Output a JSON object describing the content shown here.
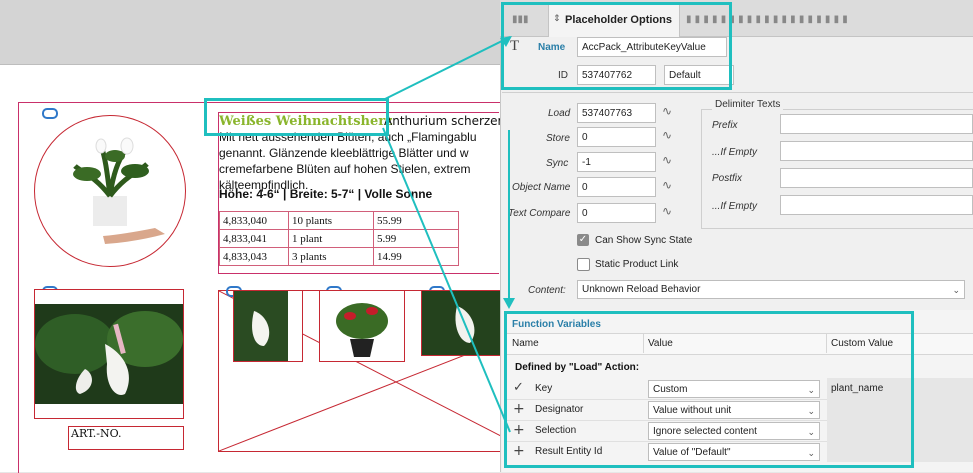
{
  "panel": {
    "tab_title": "Placeholder Options",
    "name_label": "Name",
    "name_value": "AccPack_AttributeKeyValue",
    "id_label": "ID",
    "id_value": "537407762",
    "id_default": "Default",
    "load_label": "Load",
    "load_value": "537407763",
    "store_label": "Store",
    "store_value": "0",
    "sync_label": "Sync",
    "sync_value": "-1",
    "object_name_label": "Object Name",
    "object_name_value": "0",
    "text_compare_label": "Text Compare",
    "text_compare_value": "0",
    "delimiter_title": "Delimiter Texts",
    "prefix_label": "Prefix",
    "if_empty_label": "...If Empty",
    "postfix_label": "Postfix",
    "if_empty2_label": "...If Empty",
    "can_show_sync_label": "Can Show Sync State",
    "static_product_link_label": "Static Product Link",
    "content_label": "Content:",
    "content_value": "Unknown Reload Behavior"
  },
  "function_variables": {
    "title": "Function Variables",
    "col_name": "Name",
    "col_value": "Value",
    "col_custom": "Custom Value",
    "section": "Defined by \"Load\" Action:",
    "rows": [
      {
        "name": "Key",
        "value": "Custom",
        "custom": "plant_name",
        "icon": "check-icon"
      },
      {
        "name": "Designator",
        "value": "Value without unit",
        "custom": "",
        "icon": "plus-icon"
      },
      {
        "name": "Selection",
        "value": "Ignore selected content",
        "custom": "",
        "icon": "plus-icon"
      },
      {
        "name": "Result Entity Id",
        "value": "Value of \"Default\"",
        "custom": "",
        "icon": "plus-icon"
      }
    ]
  },
  "document": {
    "heading": "Weißes Weihnachtsherz",
    "heading_tail": "Anthurium scherzeria",
    "line2": "Mit nett aussehenden Blüten, auch „Flamingablu",
    "line3": "genannt. Glänzende kleeblättrige Blätter und w",
    "line4": "cremefarbene Blüten auf hohen Stielen, extrem",
    "line5": "kälteempfindlich.",
    "specs": "Höhe: 4-6“ | Breite: 5-7“ | Volle Sonne",
    "table": [
      [
        "4,833,040",
        "10 plants",
        "55.99"
      ],
      [
        "4,833,041",
        "1 plant",
        "5.99"
      ],
      [
        "4,833,043",
        "3 plants",
        "14.99"
      ]
    ],
    "art_no": "ART.-NO."
  },
  "colors": {
    "heading_green": "#8ab52c",
    "accent_cyan": "#1fbfbf",
    "frame_red": "#c62833",
    "section_blue": "#2a7fa8"
  }
}
